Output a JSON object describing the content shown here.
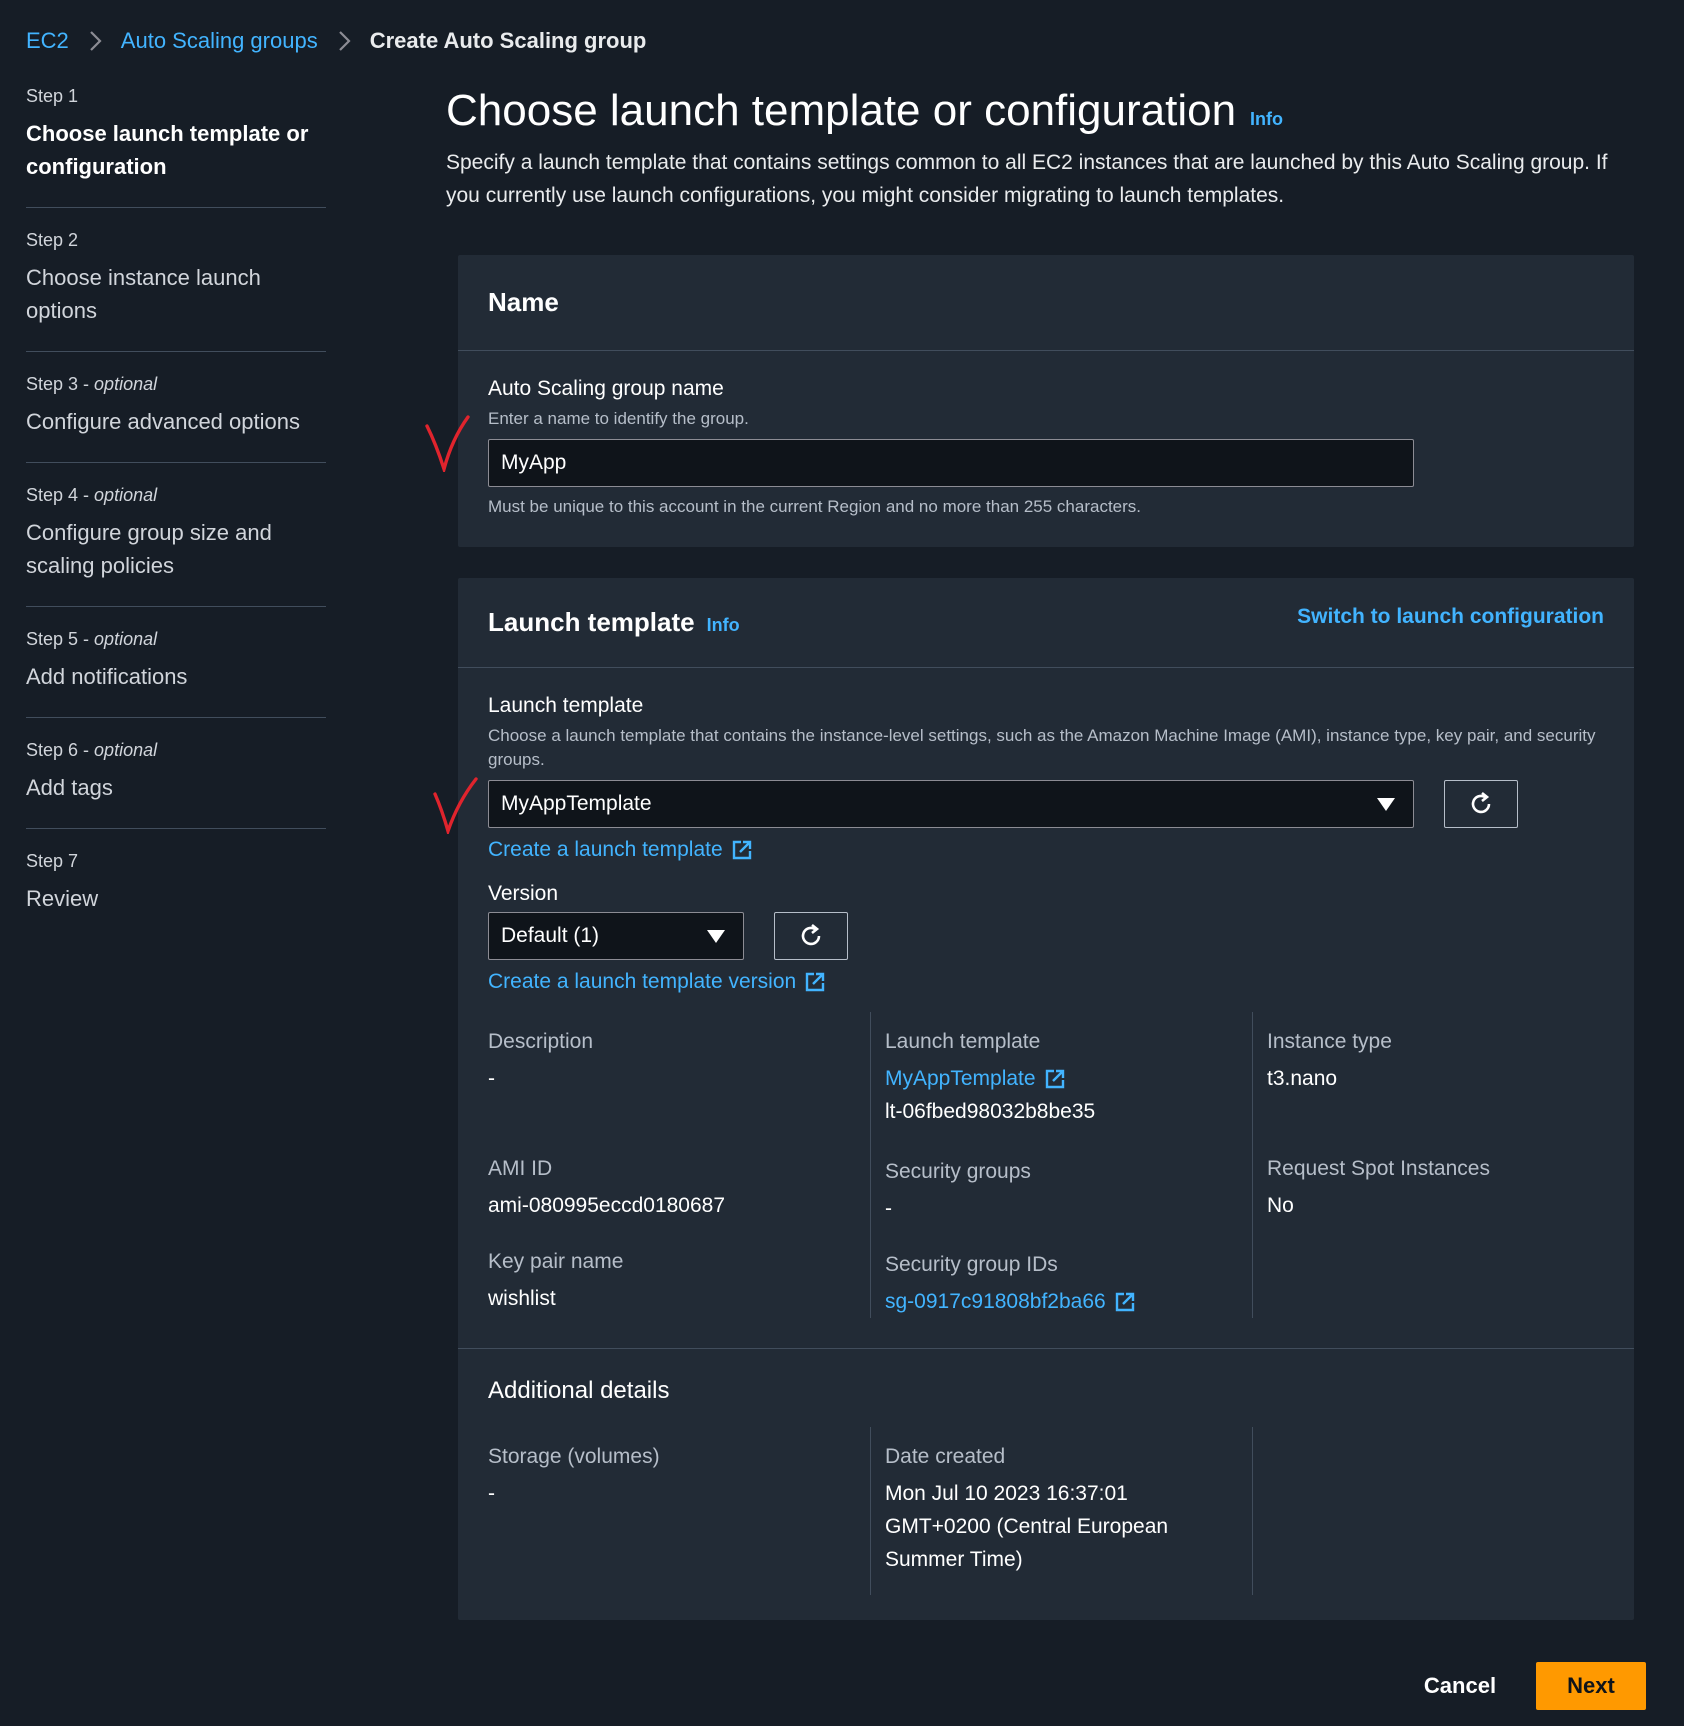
{
  "breadcrumb": {
    "items": [
      "EC2",
      "Auto Scaling groups"
    ],
    "current": "Create Auto Scaling group"
  },
  "steps": [
    {
      "num": "Step 1",
      "optional": "",
      "title": "Choose launch template or configuration"
    },
    {
      "num": "Step 2",
      "optional": "",
      "title": "Choose instance launch options"
    },
    {
      "num": "Step 3 - ",
      "optional": "optional",
      "title": "Configure advanced options"
    },
    {
      "num": "Step 4 - ",
      "optional": "optional",
      "title": "Configure group size and scaling policies"
    },
    {
      "num": "Step 5 - ",
      "optional": "optional",
      "title": "Add notifications"
    },
    {
      "num": "Step 6 - ",
      "optional": "optional",
      "title": "Add tags"
    },
    {
      "num": "Step 7",
      "optional": "",
      "title": "Review"
    }
  ],
  "page": {
    "title": "Choose launch template or configuration",
    "info": "Info",
    "description": "Specify a launch template that contains settings common to all EC2 instances that are launched by this Auto Scaling group. If you currently use launch configurations, you might consider migrating to launch templates."
  },
  "name_card": {
    "title": "Name",
    "field_label": "Auto Scaling group name",
    "field_desc": "Enter a name to identify the group.",
    "value": "MyApp",
    "hint": "Must be unique to this account in the current Region and no more than 255 characters."
  },
  "template_card": {
    "title": "Launch template",
    "info": "Info",
    "switch_link": "Switch to launch configuration",
    "field_label": "Launch template",
    "field_desc": "Choose a launch template that contains the instance-level settings, such as the Amazon Machine Image (AMI), instance type, key pair, and security groups.",
    "selected": "MyAppTemplate",
    "create_link": "Create a launch template",
    "version_label": "Version",
    "version_selected": "Default (1)",
    "create_version_link": "Create a launch template version",
    "details": {
      "description_key": "Description",
      "description_val": "-",
      "ami_key": "AMI ID",
      "ami_val": "ami-080995eccd0180687",
      "keypair_key": "Key pair name",
      "keypair_val": "wishlist",
      "lt_key": "Launch template",
      "lt_link": "MyAppTemplate",
      "lt_id": "lt-06fbed98032b8be35",
      "sg_key": "Security groups",
      "sg_val": "-",
      "sgid_key": "Security group IDs",
      "sgid_link": "sg-0917c91808bf2ba66",
      "itype_key": "Instance type",
      "itype_val": "t3.nano",
      "spot_key": "Request Spot Instances",
      "spot_val": "No"
    },
    "additional": {
      "title": "Additional details",
      "storage_key": "Storage (volumes)",
      "storage_val": "-",
      "date_key": "Date created",
      "date_val": "Mon Jul 10 2023 16:37:01 GMT+0200 (Central European Summer Time)"
    }
  },
  "footer": {
    "cancel": "Cancel",
    "next": "Next"
  },
  "colors": {
    "background": "#161d26",
    "card": "#222b36",
    "link": "#42b4ff",
    "primary": "#ff9900",
    "annotation": "#e0242d"
  },
  "icons": [
    "chevron-right-icon",
    "caret-down-icon",
    "refresh-icon",
    "external-link-icon",
    "checkmark-annotation"
  ]
}
